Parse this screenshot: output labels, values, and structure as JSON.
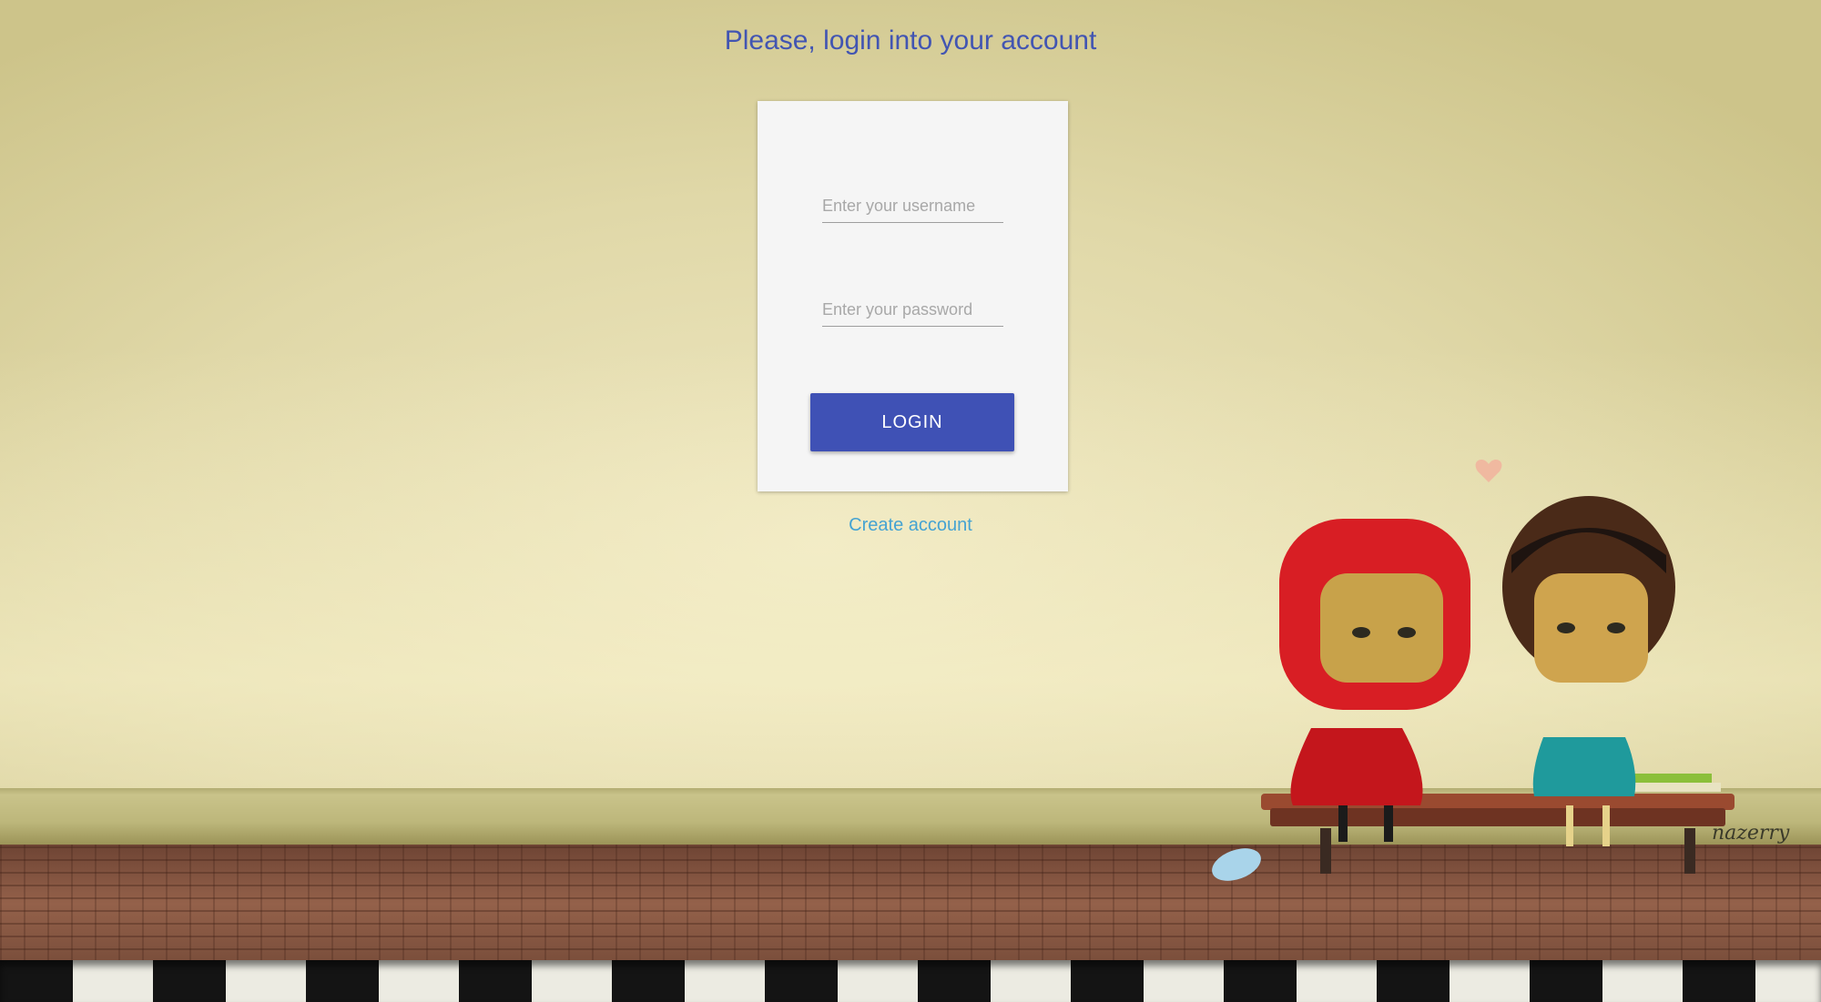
{
  "header": {
    "title": "Please, login into your account"
  },
  "login_form": {
    "username": {
      "placeholder": "Enter your username",
      "value": ""
    },
    "password": {
      "placeholder": "Enter your password",
      "value": ""
    },
    "login_button": "LOGIN"
  },
  "footer": {
    "create_account_link": "Create account"
  },
  "background": {
    "artist_signature": "nazerry"
  },
  "colors": {
    "accent": "#3f51b5",
    "title": "#4255b2",
    "link": "#45a3d2",
    "card": "#f5f5f5"
  }
}
